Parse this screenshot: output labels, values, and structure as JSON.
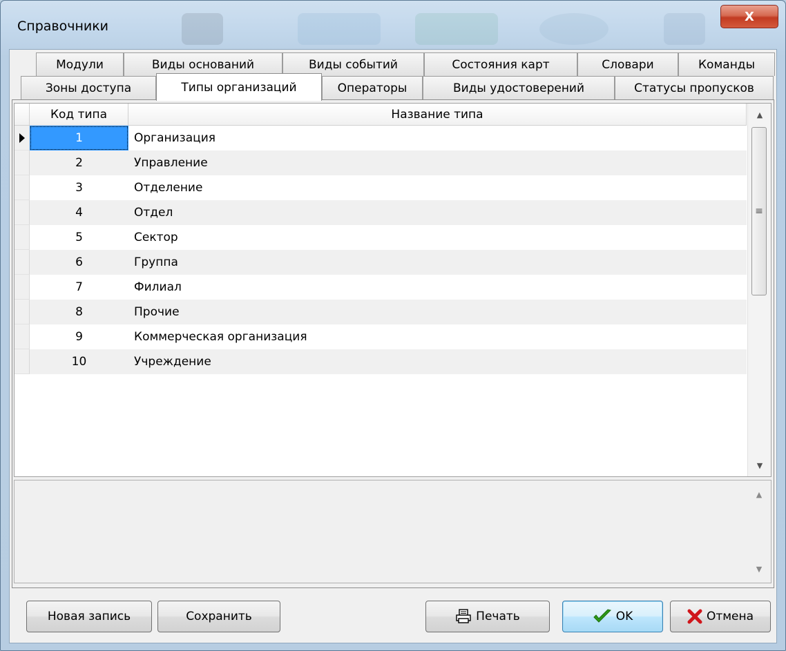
{
  "window": {
    "title": "Справочники",
    "close_label": "X"
  },
  "tabs": {
    "row_top": [
      "Модули",
      "Виды оснований",
      "Виды событий",
      "Состояния карт",
      "Словари",
      "Команды"
    ],
    "row_bottom": [
      "Зоны доступа",
      "Типы организаций",
      "Операторы",
      "Виды удостоверений",
      "Статусы пропусков"
    ],
    "active": "Типы организаций"
  },
  "grid": {
    "columns": [
      "Код типа",
      "Название типа"
    ],
    "rows": [
      {
        "code": "1",
        "name": "Организация"
      },
      {
        "code": "2",
        "name": "Управление"
      },
      {
        "code": "3",
        "name": "Отделение"
      },
      {
        "code": "4",
        "name": "Отдел"
      },
      {
        "code": "5",
        "name": "Сектор"
      },
      {
        "code": "6",
        "name": "Группа"
      },
      {
        "code": "7",
        "name": "Филиал"
      },
      {
        "code": "8",
        "name": "Прочие"
      },
      {
        "code": "9",
        "name": "Коммерческая организация"
      },
      {
        "code": "10",
        "name": "Учреждение"
      }
    ],
    "selected_row": 0
  },
  "buttons": {
    "new_record": "Новая запись",
    "save": "Сохранить",
    "print": "Печать",
    "ok": "OK",
    "cancel": "Отмена"
  },
  "icons": {
    "print": "printer-icon",
    "ok": "checkmark-icon",
    "cancel": "red-x-icon",
    "row_pointer": "row-pointer-icon"
  },
  "colors": {
    "selection": "#3399ff",
    "ok_check": "#2e9a18",
    "cancel_x": "#d0161b",
    "close_button": "#c9452c"
  }
}
